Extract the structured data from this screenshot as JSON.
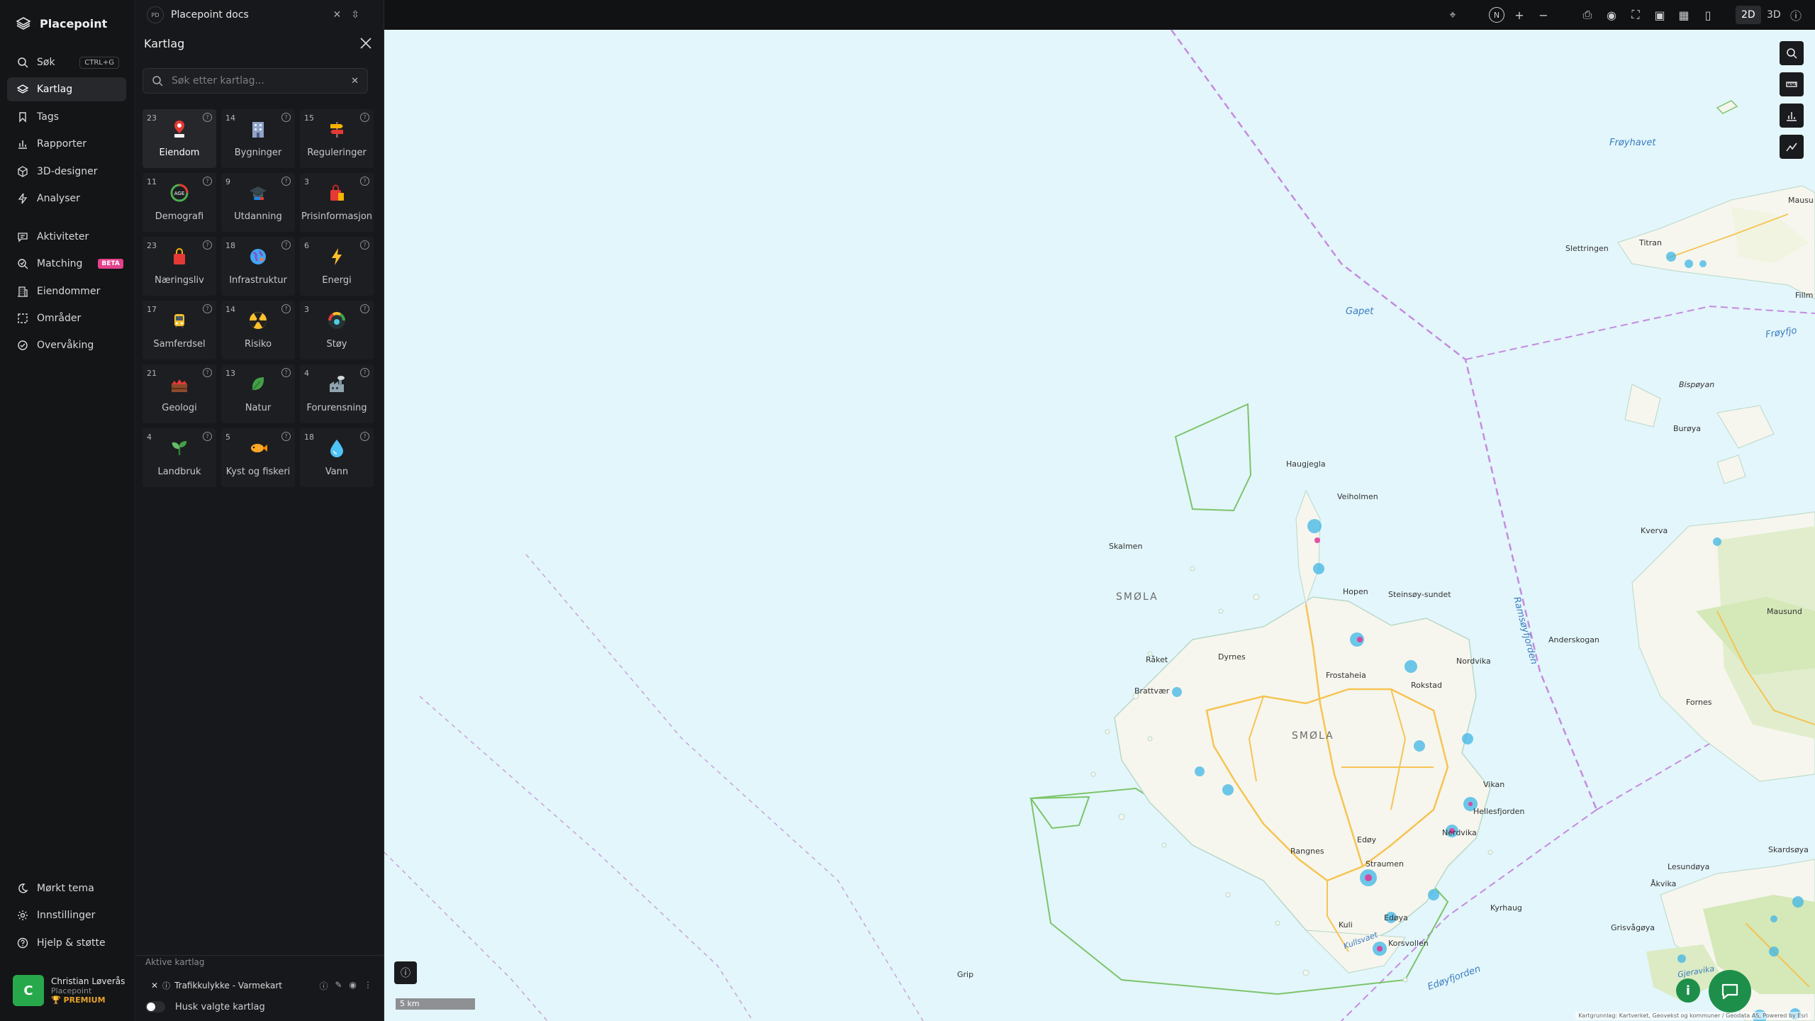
{
  "app": {
    "name": "Placepoint"
  },
  "nav": {
    "search": {
      "label": "Søk",
      "shortcut": "CTRL+G"
    },
    "items": [
      {
        "label": "Kartlag",
        "icon": "layers-icon",
        "active": true
      },
      {
        "label": "Tags",
        "icon": "bookmark-icon"
      },
      {
        "label": "Rapporter",
        "icon": "bar-chart-icon"
      },
      {
        "label": "3D-designer",
        "icon": "cube-icon"
      },
      {
        "label": "Analyser",
        "icon": "bolt-icon"
      },
      {
        "label": "Aktiviteter",
        "icon": "chat-list-icon"
      },
      {
        "label": "Matching",
        "icon": "match-icon",
        "badge": "BETA"
      },
      {
        "label": "Eiendommer",
        "icon": "building-icon"
      },
      {
        "label": "Områder",
        "icon": "area-icon"
      },
      {
        "label": "Overvåking",
        "icon": "monitor-icon"
      }
    ],
    "bottom": [
      {
        "label": "Mørkt tema",
        "icon": "moon-icon"
      },
      {
        "label": "Innstillinger",
        "icon": "gear-icon"
      },
      {
        "label": "Hjelp & støtte",
        "icon": "help-icon"
      }
    ]
  },
  "user": {
    "initial": "C",
    "name": "Christian Løverås",
    "org": "Placepoint",
    "tier": "PREMIUM"
  },
  "doc": {
    "badge": "PD",
    "title": "Placepoint docs"
  },
  "panel": {
    "title": "Kartlag",
    "search_placeholder": "Søk etter kartlag...",
    "categories": [
      {
        "count": "23",
        "label": "Eiendom",
        "icon": "pin-icon",
        "active": true
      },
      {
        "count": "14",
        "label": "Bygninger",
        "icon": "building-icon"
      },
      {
        "count": "15",
        "label": "Reguleringer",
        "icon": "signpost-icon"
      },
      {
        "count": "11",
        "label": "Demografi",
        "icon": "age-icon"
      },
      {
        "count": "9",
        "label": "Utdanning",
        "icon": "graduation-icon"
      },
      {
        "count": "3",
        "label": "Prisinformasjon",
        "icon": "price-bag-icon"
      },
      {
        "count": "23",
        "label": "Næringsliv",
        "icon": "shopping-bag-icon"
      },
      {
        "count": "18",
        "label": "Infrastruktur",
        "icon": "globe-icon"
      },
      {
        "count": "6",
        "label": "Energi",
        "icon": "lightning-icon"
      },
      {
        "count": "17",
        "label": "Samferdsel",
        "icon": "bus-icon"
      },
      {
        "count": "14",
        "label": "Risiko",
        "icon": "radiation-icon"
      },
      {
        "count": "3",
        "label": "Støy",
        "icon": "noise-gauge-icon"
      },
      {
        "count": "21",
        "label": "Geologi",
        "icon": "terrain-icon"
      },
      {
        "count": "13",
        "label": "Natur",
        "icon": "leaf-icon"
      },
      {
        "count": "4",
        "label": "Forurensning",
        "icon": "factory-icon"
      },
      {
        "count": "4",
        "label": "Landbruk",
        "icon": "sprout-icon"
      },
      {
        "count": "5",
        "label": "Kyst og fiskeri",
        "icon": "fish-icon"
      },
      {
        "count": "18",
        "label": "Vann",
        "icon": "water-drop-icon"
      }
    ],
    "active_title": "Aktive kartlag",
    "active_layers": [
      {
        "label": "Trafikkulykke - Varmekart"
      }
    ],
    "remember_label": "Husk valgte kartlag"
  },
  "toolbar": {
    "north": "N",
    "mode_2d": "2D",
    "mode_3d": "3D"
  },
  "map": {
    "scale": "5 km",
    "attribution": "Kartgrunnlag: Kartverket, Geovekst og kommuner / Geodata AS, Powered by Esri",
    "sea_labels": [
      "Frøyhavet",
      "Gapet",
      "Ramsøyfjorden",
      "Edøyfjorden",
      "Kullsvaet",
      "Frøyfjo",
      "Gjeravika"
    ],
    "region_labels": [
      "SMØLA",
      "SMØLA"
    ],
    "places": [
      "Haugjegla",
      "Veiholmen",
      "Skalmen",
      "Hopen",
      "Steinsøy-sundet",
      "Dyrnes",
      "Råket",
      "Brattvær",
      "Frostaheia",
      "Rokstad",
      "Nordvika",
      "Vikan",
      "Hellesfjorden",
      "Nerdvika",
      "Edøy",
      "Straumen",
      "Rangnes",
      "Kuli",
      "Edøya",
      "Korsvollen",
      "Kyrhaug",
      "Grip",
      "Slettringen",
      "Titran",
      "Bispøyan",
      "Burøya",
      "Kverva",
      "Anderskogan",
      "Mausund",
      "Fornes",
      "Lesundøya",
      "Åkvika",
      "Grisvågøya",
      "Skardsøya",
      "Fillm",
      "Mausu"
    ]
  },
  "colors": {
    "accent_green": "#27a84a",
    "beta_pink": "#e3418c",
    "sea": "#e3f6fb",
    "land": "#fbfbf6",
    "boundary": "#c58be0"
  }
}
